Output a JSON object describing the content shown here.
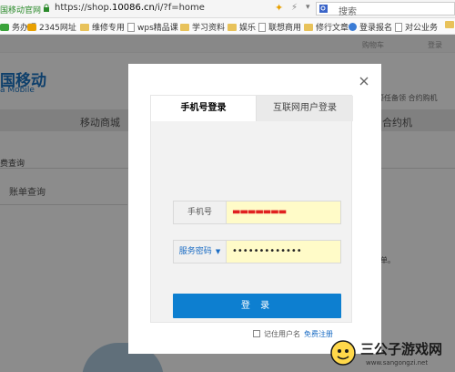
{
  "browser": {
    "tab_title": "国移动官网",
    "url_prefix": "https://shop.",
    "url_host": "10086.cn",
    "url_suffix": "/i/?f=home",
    "search_placeholder": "搜索"
  },
  "bookmarks": [
    {
      "label": "务办理",
      "icon": "green"
    },
    {
      "label": "2345网址",
      "icon": "logo2345"
    },
    {
      "label": "维修专用",
      "icon": "folder"
    },
    {
      "label": "wps精品课",
      "icon": "page"
    },
    {
      "label": "学习资料",
      "icon": "folder"
    },
    {
      "label": "娱乐",
      "icon": "folder"
    },
    {
      "label": "联想商用",
      "icon": "page"
    },
    {
      "label": "修行文章",
      "icon": "folder"
    },
    {
      "label": "登录报名",
      "icon": "globe"
    },
    {
      "label": "对公业务",
      "icon": "page"
    },
    {
      "label": "",
      "icon": "folder"
    }
  ],
  "page": {
    "cart": "购物车",
    "login": "登录",
    "brand": "国移动",
    "brand_en": "a Mobile",
    "links_right": "鎏任备领   合约购机",
    "nav": [
      "移动商城",
      "合约机"
    ],
    "sidebar_title": "费查询",
    "bill_query": "账单查询",
    "bill_note": "的话费账单。"
  },
  "modal": {
    "tab_active": "手机号登录",
    "tab_inactive": "互联网用户登录",
    "phone_label": "手机号",
    "phone_value": "▬▬▬▬▬▬▬",
    "password_type": "服务密码",
    "password_value": "•••••••••••••",
    "login_button": "登 录",
    "remember_label": "记住用户名",
    "register_link": "免费注册",
    "close_icon": "close-icon"
  },
  "watermark": {
    "title": "三公子游戏网",
    "url": "www.sangongzi.net"
  }
}
